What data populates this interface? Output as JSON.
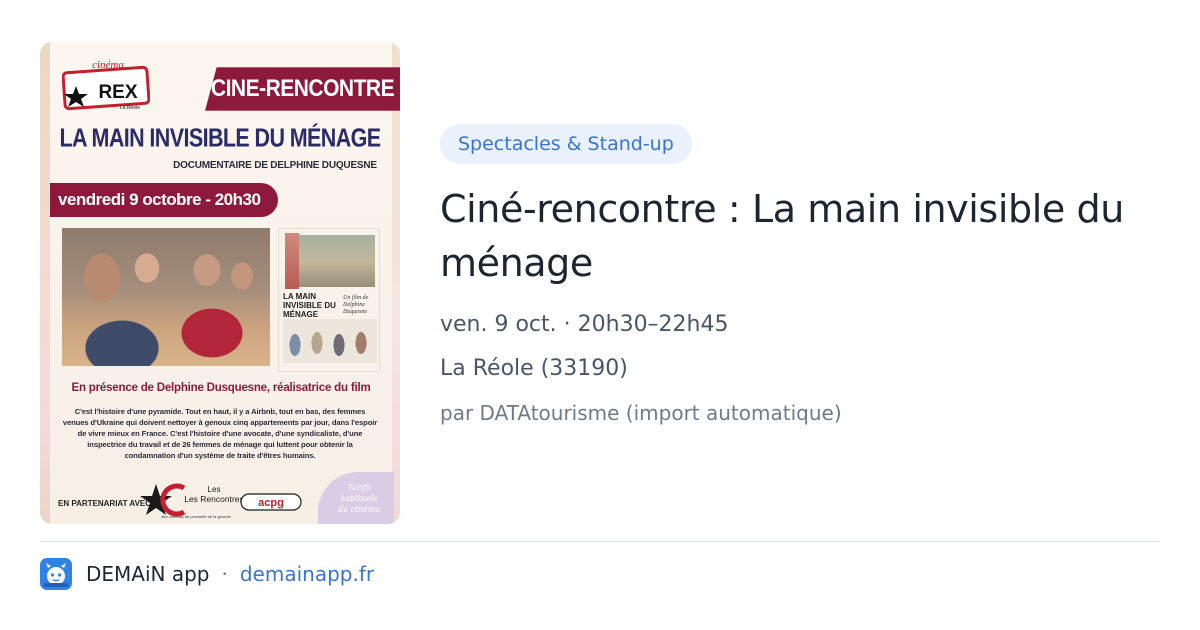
{
  "poster": {
    "rex_small": "cinéma",
    "rex_big": "REX",
    "rex_town": "La Réole",
    "banner": "CINE-RENCONTRE",
    "film_title": "LA MAIN INVISIBLE DU MÉNAGE",
    "doc_subtitle": "DOCUMENTAIRE DE DELPHINE DUQUESNE",
    "date_line": "vendredi 9 octobre - 20h30",
    "mini_poster_title": "LA MAIN INVISIBLE DU MÉNAGE",
    "mini_poster_credit": "Un film de Delphine Duquesne",
    "presence": "En présence de Delphine Dusquesne, réalisatrice du film",
    "synopsis": "C'est l'histoire d'une pyramide. Tout en haut, il y a Airbnb, tout en bas, des femmes venues d'Ukraine qui doivent nettoyer à genoux cinq appartements par jour, dans l'espoir de vivre mieux en France. C'est l'histoire d'une avocate, d'une syndicaliste, d'une inspectrice du travail et de 26 femmes de ménage qui luttent pour obtenir la condamnation d'un système de traite d'êtres humains.",
    "partner_label": "EN PARTENARIAT AVEC",
    "rencontres_logo": "Les Rencontres",
    "rencontres_sub": "des cinémas de proximité de la gironde",
    "acpg_logo": "acpg",
    "tarifs_badge": "Tarifs\nhabituels\ndu cinéma"
  },
  "event": {
    "category": "Spectacles & Stand-up",
    "title": "Ciné-rencontre : La main invisible du ménage",
    "when": "ven. 9 oct. · 20h30–22h45",
    "where": "La Réole (33190)",
    "source": "par DATAtourisme (import automatique)"
  },
  "footer": {
    "app_icon": "demain-app-icon",
    "app_name": "DEMAiN app",
    "separator": "·",
    "domain": "demainapp.fr"
  },
  "colors": {
    "accent": "#3b74cc",
    "tag_bg": "#e9f1fd",
    "poster_banner": "#8d1a3c",
    "poster_title": "#2b2b6a",
    "app_icon_bg": "#2f82e6"
  }
}
